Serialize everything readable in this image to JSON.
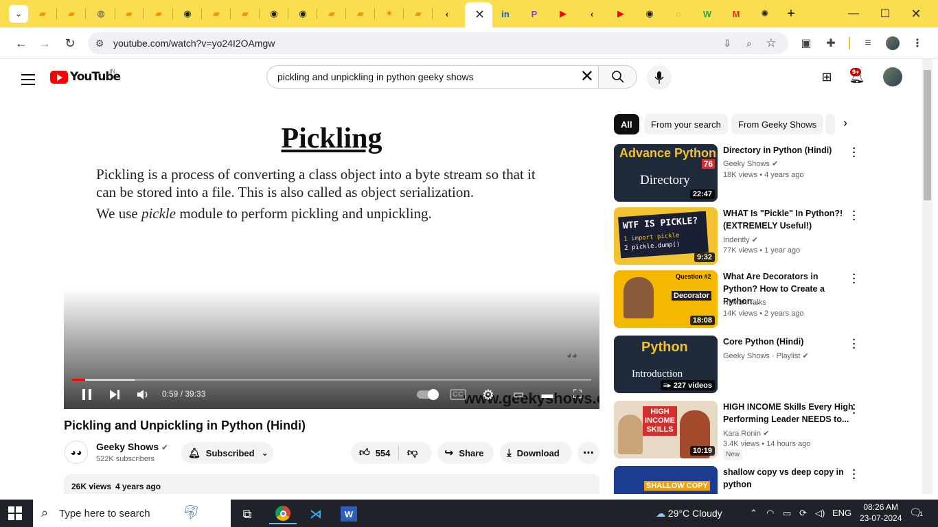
{
  "browser": {
    "tabs": [
      {
        "icon": "doc-icon",
        "glyph": "▰",
        "color": "#f29900"
      },
      {
        "icon": "doc-icon",
        "glyph": "▰",
        "color": "#f29900"
      },
      {
        "icon": "globe-icon",
        "glyph": "◍",
        "color": "#555555"
      },
      {
        "icon": "doc-icon",
        "glyph": "▰",
        "color": "#f29900"
      },
      {
        "icon": "doc-icon",
        "glyph": "▰",
        "color": "#f29900"
      },
      {
        "icon": "github-icon",
        "glyph": "◉",
        "color": "#222222"
      },
      {
        "icon": "doc-icon",
        "glyph": "▰",
        "color": "#f29900"
      },
      {
        "icon": "doc-icon",
        "glyph": "▰",
        "color": "#f29900"
      },
      {
        "icon": "github-icon",
        "glyph": "◉",
        "color": "#222222"
      },
      {
        "icon": "github-icon",
        "glyph": "◉",
        "color": "#222222"
      },
      {
        "icon": "doc-icon",
        "glyph": "▰",
        "color": "#f29900"
      },
      {
        "icon": "doc-icon",
        "glyph": "▰",
        "color": "#f29900"
      },
      {
        "icon": "sun-icon",
        "glyph": "☀",
        "color": "#e8710a"
      },
      {
        "icon": "doc-icon",
        "glyph": "▰",
        "color": "#f29900"
      },
      {
        "icon": "code-icon",
        "glyph": "‹",
        "color": "#222222"
      }
    ],
    "tabs_right": [
      {
        "icon": "linkedin-icon",
        "glyph": "in",
        "color": "#0a66c2"
      },
      {
        "icon": "p-app-icon",
        "glyph": "P",
        "color": "#7b3fe4"
      },
      {
        "icon": "youtube-icon",
        "glyph": "▶",
        "color": "#ff0000"
      },
      {
        "icon": "code-icon",
        "glyph": "‹",
        "color": "#222222"
      },
      {
        "icon": "youtube-icon",
        "glyph": "▶",
        "color": "#ff0000"
      },
      {
        "icon": "github-icon",
        "glyph": "◉",
        "color": "#222222"
      },
      {
        "icon": "loader-icon",
        "glyph": "◌",
        "color": "#e8710a"
      },
      {
        "icon": "w-app-icon",
        "glyph": "W",
        "color": "#2da44e"
      },
      {
        "icon": "gmail-icon",
        "glyph": "M",
        "color": "#d93025"
      },
      {
        "icon": "chatgpt-icon",
        "glyph": "✺",
        "color": "#222222"
      }
    ],
    "url": "youtube.com/watch?v=yo24I2OAmgw"
  },
  "youtube": {
    "region": "IN",
    "logo_text": "YouTube",
    "search_query": "pickling and unpickling in python geeky shows",
    "notifications": "9+"
  },
  "video": {
    "slide_title": "Pickling",
    "slide_line1": "Pickling is a process of converting a class object into a byte stream so that it",
    "slide_line2": "can be stored into a file. This is also called as object serialization.",
    "slide_line3_pre": "We use ",
    "slide_line3_em": "pickle",
    "slide_line3_post": " module to perform pickling and unpickling.",
    "time": "0:59 / 39:33",
    "played_fraction": 0.025,
    "buffered_fraction": 0.12,
    "watermark_site": "www.geekyshows.com",
    "title": "Pickling and Unpickling in Python (Hindi)",
    "channel": "Geeky Shows",
    "subscribers": "522K subscribers",
    "subscribed_label": "Subscribed",
    "likes": "554",
    "share_label": "Share",
    "download_label": "Download",
    "views": "26K views",
    "age": "4 years ago"
  },
  "chips": [
    "All",
    "From your search",
    "From Geeky Shows"
  ],
  "recommendations": [
    {
      "title": "Directory in Python (Hindi)",
      "channel": "Geeky Shows",
      "meta": "18K views • 4 years ago",
      "duration": "22:47",
      "thumb_top": "Advance Python",
      "thumb_main": "Directory",
      "thumb_badge": "76",
      "bg": "#1f2a3a"
    },
    {
      "title": "WHAT Is \"Pickle\" In Python?! (EXTREMELY Useful!)",
      "channel": "Indently",
      "meta": "77K views • 1 year ago",
      "duration": "9:32",
      "thumb_top": "WTF IS PICKLE?",
      "thumb_code1": "1 import pickle",
      "thumb_code2": "2 pickle.dump()",
      "bg": "#f2c230"
    },
    {
      "title": "What Are Decorators in Python? How to Create a Python...",
      "channel": "NitMan Talks",
      "meta": "14K views • 2 years ago",
      "duration": "18:08",
      "thumb_top": "Question #2",
      "thumb_main": "Decorator",
      "bg": "#f5b800"
    },
    {
      "title": "Core Python (Hindi)",
      "channel": "Geeky Shows · Playlist",
      "meta": "",
      "duration": "227 videos",
      "thumb_top": "Python",
      "thumb_main": "Introduction",
      "bg": "#1f2a3a"
    },
    {
      "title": "HIGH INCOME Skills Every High Performing Leader NEEDS to...",
      "channel": "Kara Ronin",
      "meta": "3.4K views • 14 hours ago",
      "duration": "10:19",
      "thumb_top": "HIGH INCOME SKILLS",
      "new": "New",
      "bg": "#e8d9c4"
    },
    {
      "title": "shallow copy vs deep copy in python",
      "channel": "",
      "meta": "",
      "duration": "",
      "thumb_top": "SHALLOW COPY",
      "bg": "#1c3d8f"
    }
  ],
  "taskbar": {
    "search_placeholder": "Type here to search",
    "weather": "29°C  Cloudy",
    "lang": "ENG",
    "time": "08:26 AM",
    "date": "23-07-2024",
    "notif_count": "1"
  }
}
